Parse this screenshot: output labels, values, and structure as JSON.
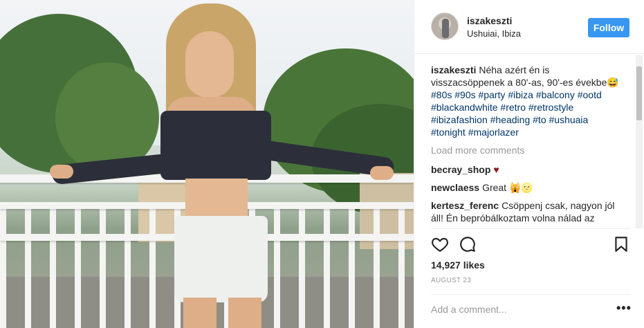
{
  "header": {
    "username": "iszakeszti",
    "location": "Ushuiai, Ibiza",
    "follow_label": "Follow"
  },
  "caption": {
    "username": "iszakeszti",
    "text": "Néha azért én is visszacsöppenek a 80'-as, 90'-es évekbe😅",
    "hashtags": [
      "#80s",
      "#90s",
      "#party",
      "#ibiza",
      "#balcony",
      "#ootd",
      "#blackandwhite",
      "#retro",
      "#retrostyle",
      "#ibizafashion",
      "#heading",
      "#to",
      "#ushuaia",
      "#tonight",
      "#majorlazer"
    ]
  },
  "load_more_label": "Load more comments",
  "comments": [
    {
      "username": "becray_shop",
      "text": "♥"
    },
    {
      "username": "newclaess",
      "text": "Great 🙀🌝"
    },
    {
      "username": "kertesz_ferenc",
      "text": "Csöppenj csak, nagyon jól áll! Én bepróbálkoztam volna nálad az Ifiparkban!"
    }
  ],
  "likes_text": "14,927 likes",
  "date_text": "AUGUST 23",
  "comment_placeholder": "Add a comment...",
  "more_label": "•••",
  "icons": {
    "like": "heart-outline-icon",
    "comment": "comment-bubble-icon",
    "save": "bookmark-icon"
  },
  "colors": {
    "follow_button": "#3897f0",
    "hashtag": "#003569",
    "muted": "#999999"
  }
}
